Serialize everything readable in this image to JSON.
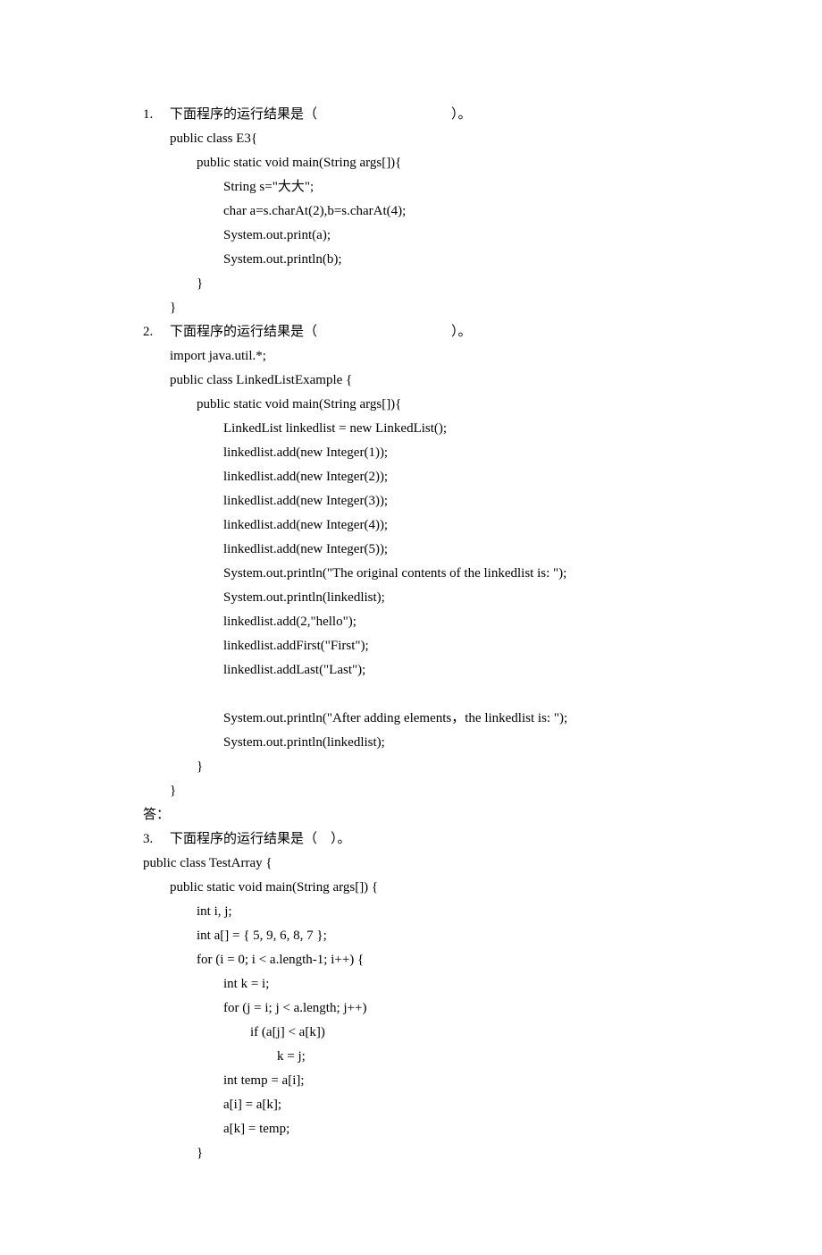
{
  "q1": {
    "num": "1.",
    "prompt_a": "下面程序的运行结果是（",
    "prompt_b": "）。",
    "lines": [
      "public class E3{",
      "public static void main(String args[]){",
      "String s=\"大大\";",
      "char a=s.charAt(2),b=s.charAt(4);",
      "System.out.print(a);",
      "System.out.println(b);",
      "}",
      "}"
    ]
  },
  "q2": {
    "num": "2.",
    "prompt_a": "下面程序的运行结果是（",
    "prompt_b": "）。",
    "lines": [
      "import java.util.*;",
      "public class LinkedListExample {",
      "public static void main(String args[]){",
      "LinkedList linkedlist = new LinkedList();",
      "linkedlist.add(new Integer(1));",
      "linkedlist.add(new Integer(2));",
      "linkedlist.add(new Integer(3));",
      "linkedlist.add(new Integer(4));",
      "linkedlist.add(new Integer(5));",
      "System.out.println(\"The original contents of the linkedlist is: \");",
      "System.out.println(linkedlist);",
      "linkedlist.add(2,\"hello\");",
      "linkedlist.addFirst(\"First\");",
      "linkedlist.addLast(\"Last\");",
      "",
      "System.out.println(\"After adding elements，the linkedlist is: \");",
      "System.out.println(linkedlist);",
      "}",
      "}"
    ],
    "answer_label": "答："
  },
  "q3": {
    "num": "3.",
    "prompt_a": "下面程序的运行结果是（",
    "prompt_b": "）。",
    "prompt_gap": "    ",
    "lines": [
      "public class TestArray {",
      "public static void main(String args[]) {",
      "int i, j;",
      "int a[] = { 5, 9, 6, 8, 7 };",
      "for (i = 0; i < a.length-1; i++) {",
      "int k = i;",
      "for (j = i; j < a.length; j++)",
      "if (a[j] < a[k])",
      "k = j;",
      "int temp = a[i];",
      "a[i] = a[k];",
      "a[k] = temp;",
      "}"
    ]
  }
}
